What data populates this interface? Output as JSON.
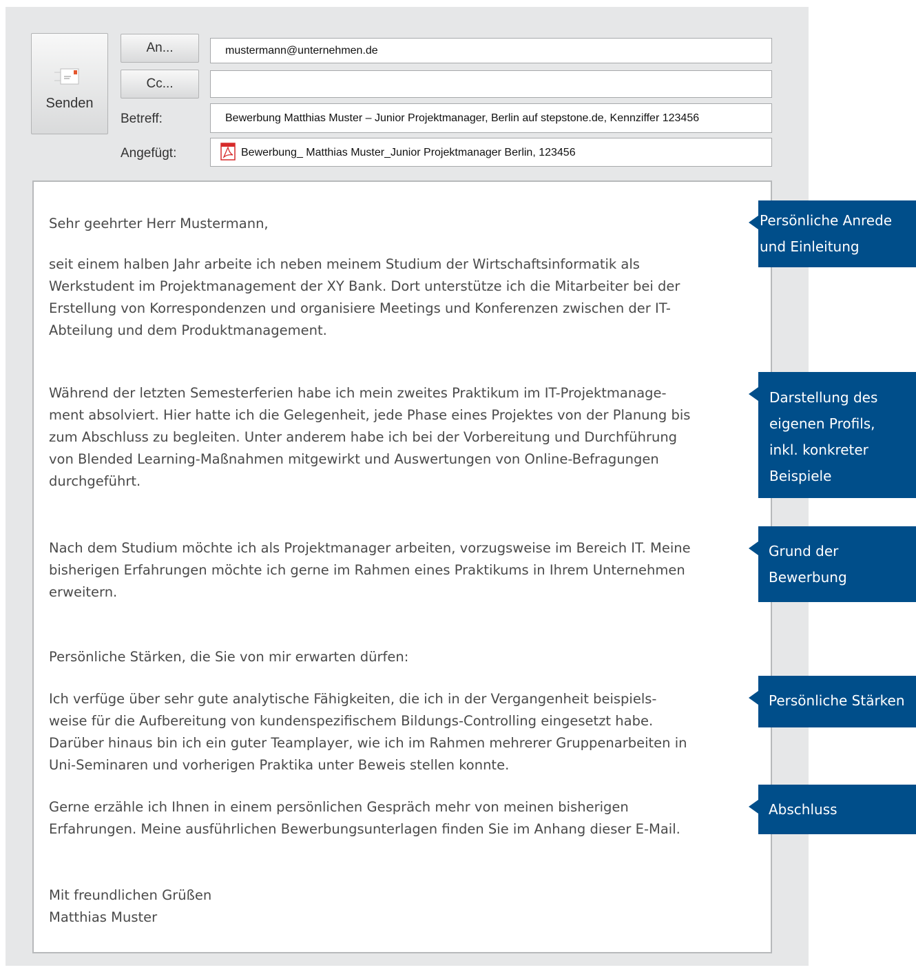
{
  "header": {
    "send_label": "Senden",
    "to_button_label": "An...",
    "cc_button_label": "Cc...",
    "subject_label": "Betreff:",
    "attached_label": "Angefügt:",
    "to_value": "mustermann@unternehmen.de",
    "cc_value": "",
    "subject_value": "Bewerbung Matthias Muster – Junior Projektmanager, Berlin auf stepstone.de, Kennziffer 123456",
    "attachment_name": "Bewerbung_ Matthias Muster_Junior Projektmanager Berlin, 123456"
  },
  "body": {
    "greeting": "Sehr geehrter Herr Mustermann,",
    "paragraph1": "seit einem halben Jahr arbeite ich neben meinem Studium der Wirtschaftsinformatik als\nWerkstudent im Projektmanagement der XY Bank. Dort unterstütze ich die Mitarbeiter bei der\nErstellung von Korrespondenzen und organisiere Meetings und Konferenzen zwischen der IT-\nAbteilung und dem Produktmanagement.",
    "paragraph2": "Während der letzten Semesterferien habe ich mein zweites Praktikum im IT-Projektmanage-\nment absolviert. Hier hatte ich die Gelegenheit, jede Phase eines Projektes von der Planung bis\nzum Abschluss zu begleiten. Unter anderem habe ich bei der Vorbereitung und Durchführung\nvon Blended Learning-Maßnahmen mitgewirkt und Auswertungen von Online-Befragungen\ndurchgeführt.",
    "paragraph3": "Nach dem Studium möchte ich als Projektmanager arbeiten, vorzugsweise im Bereich IT. Meine\nbisherigen Erfahrungen möchte ich gerne im Rahmen eines Praktikums in Ihrem Unternehmen\nerweitern.",
    "strengths_intro": "Persönliche Stärken, die Sie von mir erwarten dürfen:",
    "paragraph4": "Ich verfüge über sehr gute analytische Fähigkeiten, die ich in der Vergangenheit beispiels-\nweise für die Aufbereitung von kundenspezifischem Bildungs-Controlling eingesetzt habe.\nDarüber hinaus bin ich ein guter Teamplayer, wie ich im Rahmen mehrerer Gruppenarbeiten in\nUni-Seminaren und vorherigen Praktika unter Beweis stellen konnte.",
    "paragraph5": "Gerne erzähle ich Ihnen in einem persönlichen Gespräch mehr von meinen bisherigen\nErfahrungen. Meine ausführlichen Bewerbungsunterlagen finden Sie im Anhang dieser E-Mail.",
    "closing": "Mit freundlichen Grüßen\nMatthias Muster"
  },
  "annotations": {
    "a1": "Persönliche Anrede\nund Einleitung",
    "a2": "Darstellung des\neigenen Profils,\ninkl. konkreter\nBeispiele",
    "a3": "Grund der\nBewerbung",
    "a4": "Persönliche Stärken",
    "a5": "Abschluss"
  },
  "colors": {
    "annotation_bg": "#004e8a",
    "panel_bg": "#e6e7e8",
    "pdf_red": "#d62b2b"
  },
  "icons": {
    "send": "envelope-icon",
    "attachment": "pdf-icon"
  }
}
